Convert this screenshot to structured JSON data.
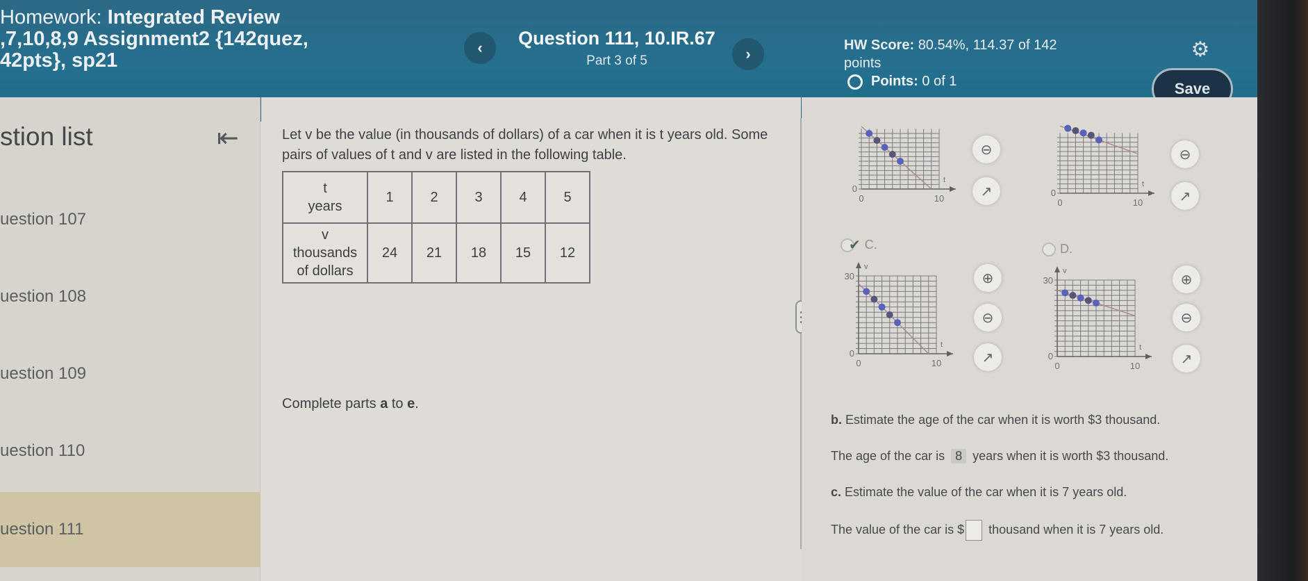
{
  "header": {
    "assignment_lead": "Homework:",
    "assignment_title_line1": "Integrated Review",
    "assignment_title_line2": ",7,10,8,9 Assignment2 {142quez,",
    "assignment_title_line3": "42pts}, sp21",
    "question_title": "Question 111, 10.IR.67",
    "question_part": "Part 3 of 5",
    "prev_icon": "chevron-left-icon",
    "next_icon": "chevron-right-icon",
    "hw_score_label": "HW Score:",
    "hw_score_value": "80.54%, 114.37 of 142",
    "hw_score_suffix": "points",
    "points_label": "Points:",
    "points_value": "0 of 1",
    "settings_icon": "gear-icon",
    "save_label": "Save"
  },
  "sidebar": {
    "title": "stion list",
    "collapse_icon": "collapse-left-icon",
    "items": [
      {
        "label": "uestion 107",
        "active": false
      },
      {
        "label": "uestion 108",
        "active": false
      },
      {
        "label": "uestion 109",
        "active": false
      },
      {
        "label": "uestion 110",
        "active": false
      },
      {
        "label": "uestion 111",
        "active": true
      }
    ]
  },
  "question": {
    "prompt": "Let v be the value (in thousands of dollars) of a car when it is t years old. Some pairs of values of t and v are listed in the following table.",
    "table": {
      "row1_header_line1": "t",
      "row1_header_line2": "years",
      "row2_header_line1": "v",
      "row2_header_line2": "thousands",
      "row2_header_line3": "of dollars",
      "t_values": [
        "1",
        "2",
        "3",
        "4",
        "5"
      ],
      "v_values": [
        "24",
        "21",
        "18",
        "15",
        "12"
      ]
    },
    "instructions_prefix": "Complete parts",
    "instructions_a": "a",
    "instructions_to": "to",
    "instructions_e": "e",
    "instructions_end": "."
  },
  "answers": {
    "option_c_label": "C.",
    "option_d_label": "D.",
    "option_c_selected": true,
    "graph_axis": {
      "x_label": "t",
      "y_label": "v",
      "x_min_label": "0",
      "x_max_label": "10",
      "y_min_label": "0",
      "y_max_label": "30"
    },
    "part_b": {
      "letter": "b.",
      "question": "Estimate the age of the car when it is worth $3 thousand.",
      "answer_prefix": "The age of the car is",
      "answer_value": "8",
      "answer_suffix": "years when it is worth $3 thousand."
    },
    "part_c": {
      "letter": "c.",
      "question": "Estimate the value of the car when it is 7 years old.",
      "answer_prefix": "The value of the car is $",
      "answer_value": "",
      "answer_suffix": "thousand when it is 7 years old."
    }
  },
  "chart_data": [
    {
      "type": "scatter",
      "name": "option-a-graph",
      "x": [
        1,
        2,
        3,
        4,
        5
      ],
      "y": [
        24,
        21,
        18,
        15,
        12
      ],
      "line": {
        "slope": -3,
        "intercept": 27
      },
      "xlim": [
        0,
        10
      ],
      "ylim": [
        0,
        30
      ],
      "xlabel": "t",
      "ylabel": "v"
    },
    {
      "type": "scatter",
      "name": "option-b-graph",
      "x": [
        1,
        2,
        3,
        4,
        5
      ],
      "y": [
        28,
        27,
        26,
        25,
        23
      ],
      "line": {
        "slope": -1.2,
        "intercept": 29
      },
      "xlim": [
        0,
        10
      ],
      "ylim": [
        0,
        30
      ],
      "xlabel": "t",
      "ylabel": "v"
    },
    {
      "type": "scatter",
      "name": "option-c-graph",
      "x": [
        1,
        2,
        3,
        4,
        5
      ],
      "y": [
        24,
        21,
        18,
        15,
        12
      ],
      "line": {
        "slope": -3,
        "intercept": 27
      },
      "xlim": [
        0,
        10
      ],
      "ylim": [
        0,
        30
      ],
      "xlabel": "t",
      "ylabel": "v"
    },
    {
      "type": "scatter",
      "name": "option-d-graph",
      "x": [
        1,
        2,
        3,
        4,
        5
      ],
      "y": [
        25,
        24,
        23,
        22,
        21
      ],
      "line": {
        "slope": -1,
        "intercept": 26
      },
      "xlim": [
        0,
        10
      ],
      "ylim": [
        0,
        30
      ],
      "xlabel": "t",
      "ylabel": "v"
    }
  ]
}
